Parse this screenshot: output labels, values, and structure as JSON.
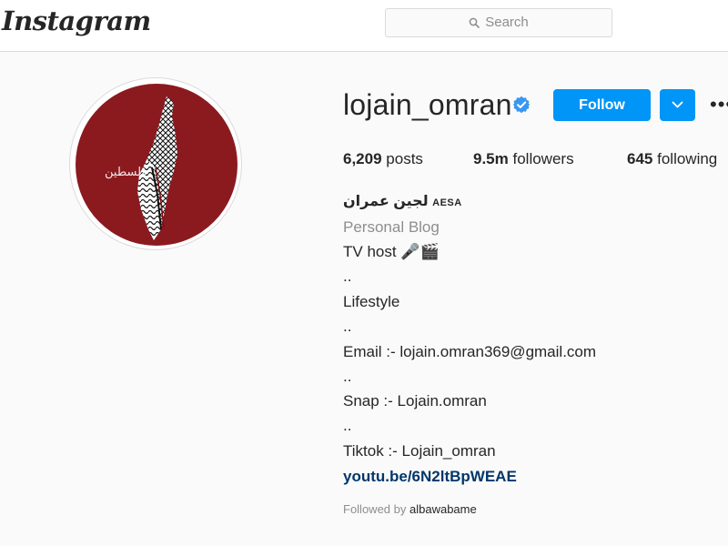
{
  "app": {
    "logo_text": "Instagram"
  },
  "search": {
    "placeholder": "Search",
    "icon": "search-icon"
  },
  "profile": {
    "username": "lojain_omran",
    "verified": true,
    "avatar": {
      "icon": "palestine-map-keffiyeh-avatar",
      "text": "فلسطين",
      "background": "#8b1a1f"
    },
    "actions": {
      "follow_label": "Follow",
      "dropdown_icon": "chevron-down-icon",
      "more_label": "•••"
    },
    "stats": {
      "posts": {
        "value": "6,209",
        "label": "posts"
      },
      "followers": {
        "value": "9.5m",
        "label": "followers"
      },
      "following": {
        "value": "645",
        "label": "following"
      }
    },
    "bio": {
      "name": "لجين عمران",
      "name_tag": "AESA",
      "category": "Personal Blog",
      "lines": [
        "TV host 🎤🎬",
        "..",
        "Lifestyle",
        "..",
        "Email :- lojain.omran369@gmail.com",
        "..",
        "Snap :- Lojain.omran",
        "..",
        "Tiktok :- Lojain_omran"
      ],
      "link": "youtu.be/6N2ltBpWEAE"
    },
    "followed_by": {
      "prefix": "Followed by",
      "user": "albawabame"
    }
  },
  "colors": {
    "accent": "#0095f6",
    "verified": "#3897f0",
    "link": "#00376b",
    "muted": "#8e8e8e",
    "text": "#262626",
    "background": "#fafafa"
  }
}
